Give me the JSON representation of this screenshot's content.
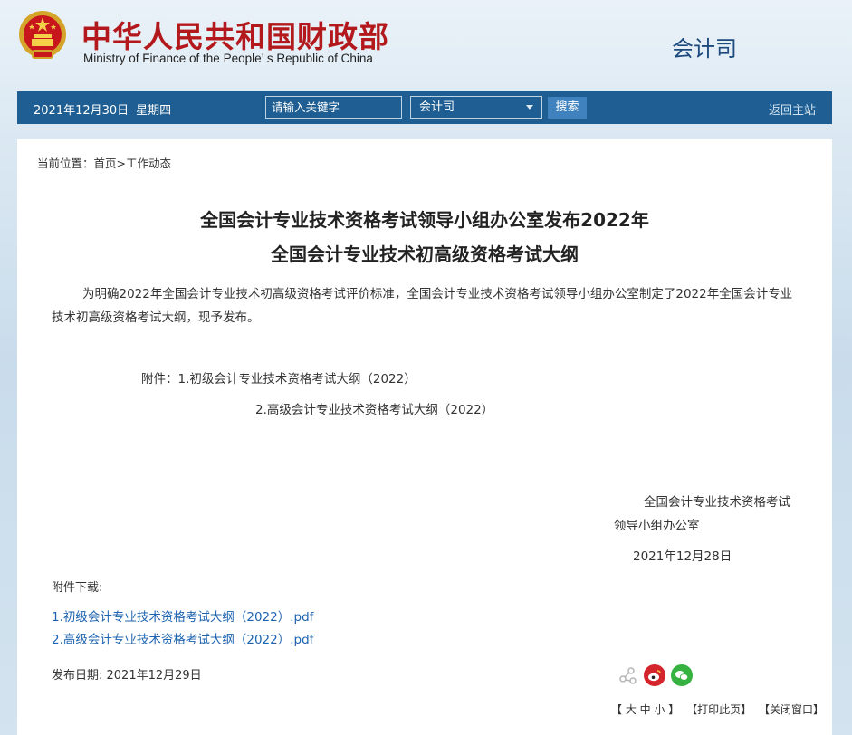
{
  "header": {
    "site_name_cn": "中华人民共和国财政部",
    "site_name_en": "Ministry of Finance of the People’ s Republic of China",
    "department": "会计司"
  },
  "nav": {
    "date": "2021年12月30日",
    "weekday": "星期四",
    "search_placeholder": "请输入关键字",
    "select_value": "会计司",
    "search_button": "搜索",
    "home_link": "返回主站"
  },
  "breadcrumb": "当前位置：首页>工作动态",
  "article": {
    "title_line1": "全国会计专业技术资格考试领导小组办公室发布2022年",
    "title_line2": "全国会计专业技术初高级资格考试大纲",
    "body": "为明确2022年全国会计专业技术初高级资格考试评价标准，全国会计专业技术资格考试领导小组办公室制定了2022年全国会计专业技术初高级资格考试大纲，现予发布。",
    "attachment1": "附件：1.初级会计专业技术资格考试大纲（2022）",
    "attachment2": "2.高级会计专业技术资格考试大纲（2022）",
    "signature_line1": "全国会计专业技术资格考试",
    "signature_line2": "领导小组办公室",
    "signature_date": "2021年12月28日"
  },
  "downloads": {
    "label": "附件下载:",
    "files": [
      "1.初级会计专业技术资格考试大纲（2022）.pdf",
      "2.高级会计专业技术资格考试大纲（2022）.pdf"
    ]
  },
  "publish_date": "发布日期:  2021年12月29日",
  "footer": {
    "font_size": "【 大 中 小 】",
    "print": "【打印此页】",
    "close": "【关闭窗口】"
  },
  "colors": {
    "brand_red": "#b3191c",
    "nav_blue": "#1e5e92",
    "link_blue": "#1e63b0"
  }
}
